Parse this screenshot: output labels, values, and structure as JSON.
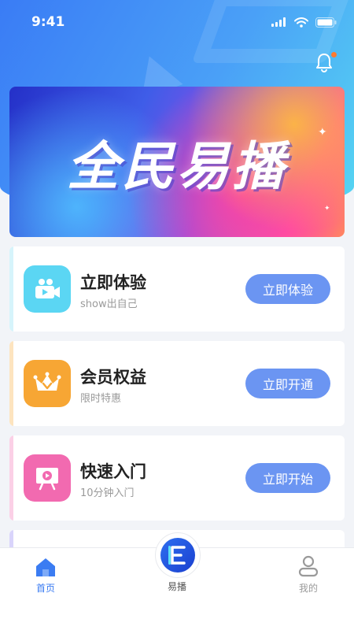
{
  "status": {
    "time": "9:41"
  },
  "banner": {
    "title": "全民易播"
  },
  "cards": [
    {
      "title": "立即体验",
      "subtitle": "show出自己",
      "button": "立即体验",
      "icon": "video-camera-icon",
      "color": "#5bd6f3",
      "stripe": "#d6f4fb"
    },
    {
      "title": "会员权益",
      "subtitle": "限时特惠",
      "button": "立即开通",
      "icon": "crown-icon",
      "color": "#f7a634",
      "stripe": "#fde4bf"
    },
    {
      "title": "快速入门",
      "subtitle": "10分钟入门",
      "button": "立即开始",
      "icon": "play-screen-icon",
      "color": "#f26ab0",
      "stripe": "#fbd0e6"
    }
  ],
  "tabs": {
    "home": "首页",
    "center": "易播",
    "mine": "我的"
  },
  "colors": {
    "accent": "#6b95f2",
    "tab_active": "#3b7cf2",
    "tab_inactive": "#9a9a9a"
  }
}
